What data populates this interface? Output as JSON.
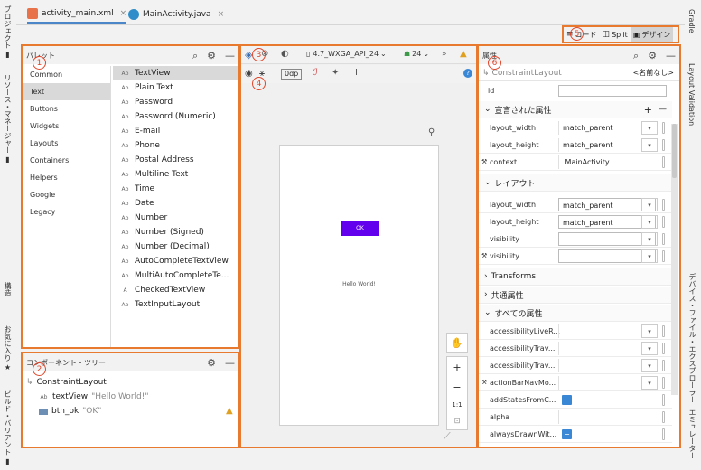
{
  "left_strip": {
    "project": "プロジェクト",
    "resource_manager": "リソース・マネージャー",
    "structure": "構造",
    "favorites": "お気に入り",
    "build_variants": "ビルド・バリアント"
  },
  "right_strip": {
    "gradle": "Gradle",
    "layout_validation": "Layout Validation",
    "device_explorer": "デバイス・ファイル・エクスプローラー",
    "emulator": "エミュレーター"
  },
  "tabs": [
    {
      "label": "activity_main.xml",
      "close": "×"
    },
    {
      "label": "MainActivity.java",
      "close": "×"
    }
  ],
  "view_modes": {
    "code": "コード",
    "split": "Split",
    "design": "デザイン"
  },
  "markers": {
    "m1": "1",
    "m2": "2",
    "m3": "3",
    "m4": "4",
    "m5": "5",
    "m6": "6"
  },
  "palette": {
    "title": "パレット",
    "categories": [
      "Common",
      "Text",
      "Buttons",
      "Widgets",
      "Layouts",
      "Containers",
      "Helpers",
      "Google",
      "Legacy"
    ],
    "selected_category": "Text",
    "widgets": [
      {
        "icon": "Ab",
        "label": "TextView"
      },
      {
        "icon": "Ab",
        "label": "Plain Text"
      },
      {
        "icon": "Ab",
        "label": "Password"
      },
      {
        "icon": "Ab",
        "label": "Password (Numeric)"
      },
      {
        "icon": "Ab",
        "label": "E-mail"
      },
      {
        "icon": "Ab",
        "label": "Phone"
      },
      {
        "icon": "Ab",
        "label": "Postal Address"
      },
      {
        "icon": "Ab",
        "label": "Multiline Text"
      },
      {
        "icon": "Ab",
        "label": "Time"
      },
      {
        "icon": "Ab",
        "label": "Date"
      },
      {
        "icon": "Ab",
        "label": "Number"
      },
      {
        "icon": "Ab",
        "label": "Number (Signed)"
      },
      {
        "icon": "Ab",
        "label": "Number (Decimal)"
      },
      {
        "icon": "Ab",
        "label": "AutoCompleteTextView"
      },
      {
        "icon": "Ab",
        "label": "MultiAutoCompleteTe..."
      },
      {
        "icon": "A",
        "label": "CheckedTextView"
      },
      {
        "icon": "Ab",
        "label": "TextInputLayout"
      }
    ]
  },
  "tree": {
    "title": "コンポーネント・ツリー",
    "root": "ConstraintLayout",
    "items": [
      {
        "icon": "Ab",
        "name": "textView",
        "value": "\"Hello World!\""
      },
      {
        "icon": "",
        "name": "btn_ok",
        "value": "\"OK\""
      }
    ]
  },
  "design_toolbar": {
    "device": "4.7_WXGA_API_24",
    "api": "24",
    "margin": "0dp"
  },
  "canvas": {
    "button_text": "OK",
    "text": "Hello World!",
    "zoom_in": "+",
    "zoom_out": "−",
    "ratio": "1:1"
  },
  "attributes": {
    "title": "属性",
    "component": "ConstraintLayout",
    "name_placeholder": "<名前なし>",
    "id_label": "id",
    "declared_section": "宣言された属性",
    "declared": [
      {
        "name": "layout_width",
        "value": "match_parent",
        "dropdown": true
      },
      {
        "name": "layout_height",
        "value": "match_parent",
        "dropdown": true
      },
      {
        "name": "context",
        "value": ".MainActivity",
        "dropdown": false
      }
    ],
    "layout_section": "レイアウト",
    "layout": [
      {
        "name": "layout_width",
        "value": "match_parent"
      },
      {
        "name": "layout_height",
        "value": "match_parent"
      },
      {
        "name": "visibility",
        "value": ""
      },
      {
        "name": "visibility",
        "value": ""
      }
    ],
    "transforms": "Transforms",
    "common": "共通属性",
    "all": "すべての属性",
    "all_items": [
      {
        "name": "accessibilityLiveR...",
        "kind": "dropdown"
      },
      {
        "name": "accessibilityTrav...",
        "kind": "dropdown"
      },
      {
        "name": "accessibilityTrav...",
        "kind": "dropdown"
      },
      {
        "name": "actionBarNavMo...",
        "kind": "dropdown"
      },
      {
        "name": "addStatesFromC...",
        "kind": "check"
      },
      {
        "name": "alpha",
        "kind": "text"
      },
      {
        "name": "alwaysDrawnWit...",
        "kind": "check"
      }
    ]
  }
}
